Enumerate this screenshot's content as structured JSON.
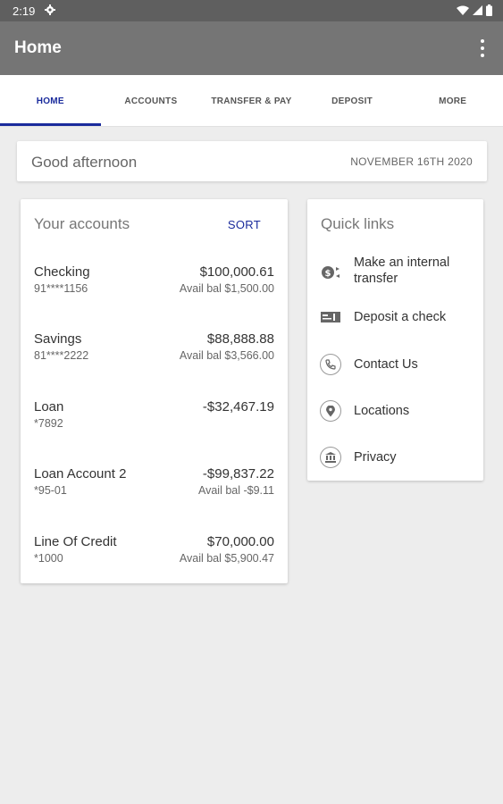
{
  "status_bar": {
    "time": "2:19"
  },
  "app_bar": {
    "title": "Home"
  },
  "tabs": [
    {
      "label": "HOME",
      "active": true
    },
    {
      "label": "ACCOUNTS",
      "active": false
    },
    {
      "label": "TRANSFER & PAY",
      "active": false
    },
    {
      "label": "DEPOSIT",
      "active": false
    },
    {
      "label": "MORE",
      "active": false
    }
  ],
  "greeting": {
    "text": "Good afternoon",
    "date": "NOVEMBER 16TH 2020"
  },
  "accounts_card": {
    "title": "Your accounts",
    "sort_label": "SORT",
    "items": [
      {
        "name": "Checking",
        "number": "91****1156",
        "amount": "$100,000.61",
        "avail": "Avail bal $1,500.00"
      },
      {
        "name": "Savings",
        "number": "81****2222",
        "amount": "$88,888.88",
        "avail": "Avail bal $3,566.00"
      },
      {
        "name": "Loan",
        "number": "*7892",
        "amount": "-$32,467.19",
        "avail": ""
      },
      {
        "name": "Loan Account 2",
        "number": "*95-01",
        "amount": "-$99,837.22",
        "avail": "Avail bal -$9.11"
      },
      {
        "name": "Line Of Credit",
        "number": "*1000",
        "amount": "$70,000.00",
        "avail": "Avail bal $5,900.47"
      }
    ]
  },
  "quick_links": {
    "title": "Quick links",
    "items": [
      {
        "line1": "Make an internal",
        "line2": "transfer",
        "icon": "transfer-icon"
      },
      {
        "line1": "Deposit a check",
        "icon": "check-icon"
      },
      {
        "line1": "Contact Us",
        "icon": "phone-icon"
      },
      {
        "line1": "Locations",
        "icon": "location-pin-icon"
      },
      {
        "line1": "Privacy",
        "icon": "bank-icon"
      }
    ]
  },
  "colors": {
    "accent": "#1a2b9c",
    "app_bar": "#757575",
    "status_bar": "#5f5f5f",
    "background": "#ededed"
  }
}
